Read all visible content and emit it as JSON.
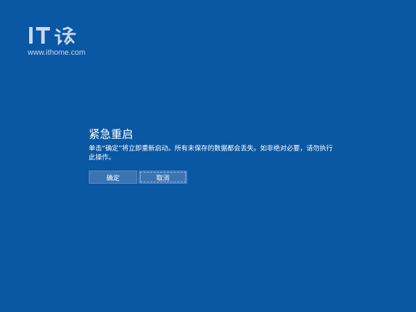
{
  "watermark": {
    "url": "www.ithome.com"
  },
  "dialog": {
    "title": "紧急重启",
    "message": "单击“确定”将立即重新启动。所有未保存的数据都会丢失。如非绝对必要，请勿执行此操作。"
  },
  "buttons": {
    "ok_label": "确定",
    "cancel_label": "取消"
  },
  "colors": {
    "background": "#0a57a3",
    "button": "#3b74b2",
    "text": "#ffffff"
  }
}
